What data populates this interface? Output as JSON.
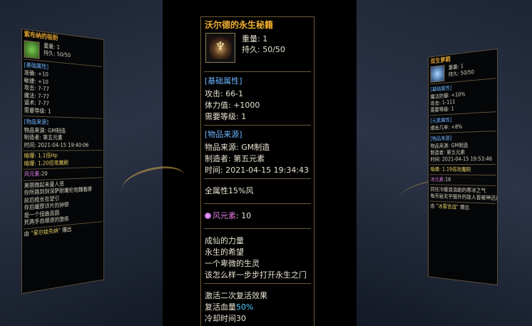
{
  "center": {
    "title": "沃尔德的永生秘籍",
    "weight": "重量: 1",
    "durability": "持久: 50/50",
    "basic_section": "[基础属性]",
    "attack": "攻击: 66-1",
    "hp": "体力值: +1000",
    "level_req": "需要等级: 1",
    "source_section": "[物品来源]",
    "source": "物品来源: GM制造",
    "maker": "制造者: 第五元素",
    "time": "时间: 2021-04-15 19:34:43",
    "all_attr": "全属性15%风",
    "wind_label": "风元素",
    "wind_value": ": 10",
    "lore": [
      "成仙的力量",
      "永生的希望",
      "一个卑微的生灵",
      "该怎么样一步步打开永生之门"
    ],
    "effect_title": "激活二次复活效果",
    "revive_label": "复活血量",
    "revive_pct": "50%",
    "cooldown_partial": "冷却时间30"
  },
  "left": {
    "title": "紫布纳的吸盼",
    "weight": "重量: 1",
    "durability": "持久: 50/50",
    "basic_section": "[基础属性]",
    "stats": [
      "准确: +10",
      "敏捷: +10",
      "攻击: 7-77",
      "魔法: 7-77",
      "道术: 7-77",
      "需要等级: 1"
    ],
    "source_section": "[物品来源]",
    "source": "物品来源: GM制造",
    "maker": "制造者: 第五元素",
    "time": "时间: 2021-04-15 19:40:06",
    "buff1": "暗爆: 1.1倍Hp",
    "buff2": "暗爆: 1.20倍攻魔刷",
    "wind_label": "风元素",
    "wind_value": ":20",
    "lore": [
      "美丽微起未曼人恶",
      "你所路到到深萨耐魔伦勃魏着撑",
      "前后梳长在望引",
      "存后缓厚详片的钟顿",
      "是一个扭曲且圆",
      "死两手自顺逐的堕练"
    ],
    "footer_prefix": "由",
    "footer_name": "\"星尔娃先纳\"",
    "footer_suffix": "爆出"
  },
  "right": {
    "title": "双生萝羁",
    "weight": "重量: 1",
    "durability": "持久: 50/50",
    "basic_section": "[基础属性]",
    "stats": [
      "魔法防御: +10%",
      "攻击: 1-111",
      "需要等级: 1"
    ],
    "element_section": "[元素属性]",
    "element_stat": "爆击几率: +8%",
    "source_section": "[物品来源]",
    "source": "物品来源: GM制造",
    "maker": "制造者: 第五元素",
    "time": "时间: 2021-04-15 19:53:46",
    "buff1": "暗爆: 1.19倍攻魔刷",
    "ice_label": "冰元素",
    "ice_value": ":16",
    "lore": [
      "同往冷暖浪浪剧的寒冰之气",
      "每天秘无乎服外的敌人皆被神迅速拯救"
    ],
    "footer_prefix": "由",
    "footer_name": "\"冰雾宫战\"",
    "footer_suffix": "爆出"
  }
}
